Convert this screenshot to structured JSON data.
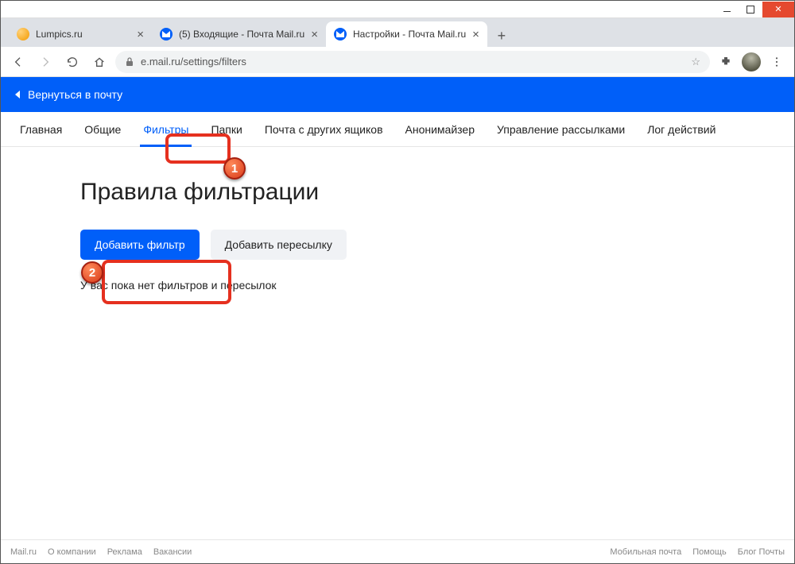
{
  "window": {
    "tabs": [
      {
        "title": "Lumpics.ru"
      },
      {
        "title": "(5) Входящие - Почта Mail.ru"
      },
      {
        "title": "Настройки - Почта Mail.ru"
      }
    ],
    "url": "e.mail.ru/settings/filters"
  },
  "backbar": {
    "label": "Вернуться в почту"
  },
  "nav": {
    "items": [
      "Главная",
      "Общие",
      "Фильтры",
      "Папки",
      "Почта с других ящиков",
      "Анонимайзер",
      "Управление рассылками",
      "Лог действий"
    ],
    "activeIndex": 2
  },
  "content": {
    "title": "Правила фильтрации",
    "add_filter": "Добавить фильтр",
    "add_forward": "Добавить пересылку",
    "empty": "У вас пока нет фильтров и пересылок"
  },
  "footer": {
    "left": [
      "Mail.ru",
      "О компании",
      "Реклама",
      "Вакансии"
    ],
    "right": [
      "Мобильная почта",
      "Помощь",
      "Блог Почты"
    ]
  },
  "annotations": {
    "one": "1",
    "two": "2"
  }
}
